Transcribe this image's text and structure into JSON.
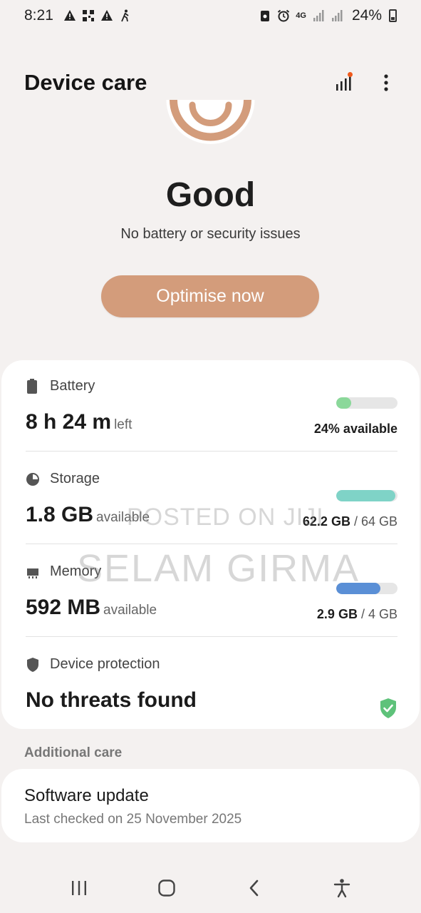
{
  "status_bar": {
    "time": "8:21",
    "network": "4G",
    "battery_percent": "24%"
  },
  "app_bar": {
    "title": "Device care"
  },
  "hero": {
    "status": "Good",
    "subtitle": "No battery or security issues",
    "optimise_label": "Optimise now"
  },
  "card": {
    "battery": {
      "label": "Battery",
      "value": "8 h 24 m",
      "suffix": "left",
      "detail": "24% available",
      "level": 0.24,
      "color": "#8bd89a"
    },
    "storage": {
      "label": "Storage",
      "value": "1.8 GB",
      "suffix": "available",
      "used": "62.2 GB",
      "total": "/ 64 GB",
      "level": 0.97,
      "color": "#7fd3c7"
    },
    "memory": {
      "label": "Memory",
      "value": "592 MB",
      "suffix": "available",
      "used": "2.9 GB",
      "total": "/ 4 GB",
      "level": 0.72,
      "color": "#5a8fd6"
    },
    "protection": {
      "label": "Device protection",
      "value": "No threats found",
      "color": "#5ec27a"
    }
  },
  "additional": {
    "header": "Additional care",
    "software_update": {
      "title": "Software update",
      "subtitle": "Last checked on 25 November 2025"
    }
  },
  "watermark": {
    "line1": "POSTED ON JIJI",
    "line2": "SELAM GIRMA"
  },
  "colors": {
    "accent": "#d39c7b",
    "background": "#f4f1f0"
  }
}
